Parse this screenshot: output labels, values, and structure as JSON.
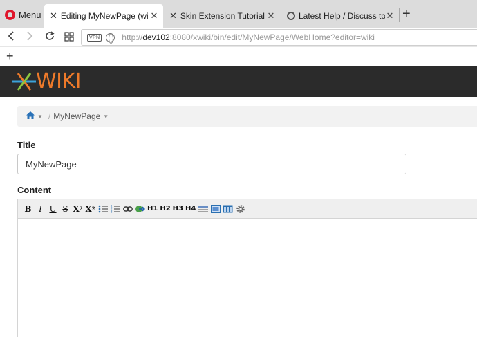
{
  "browser": {
    "menu_label": "Menu",
    "tabs": [
      {
        "title": "Editing MyNewPage (wiki",
        "favicon": "xwiki-x-icon",
        "active": true
      },
      {
        "title": "Skin Extension Tutorial (XW",
        "favicon": "xwiki-x-icon",
        "active": false
      },
      {
        "title": "Latest Help / Discuss topic",
        "favicon": "discourse-icon",
        "active": false
      }
    ],
    "url": {
      "protocol": "http://",
      "host": "dev102",
      "rest": ":8080/xwiki/bin/edit/MyNewPage/WebHome?editor=wiki"
    },
    "vpn_label": "VPN"
  },
  "xwiki": {
    "logo_text": "WIKI",
    "logo_color": "#ee7a2a",
    "breadcrumb": {
      "page": "MyNewPage"
    },
    "form": {
      "title_label": "Title",
      "title_value": "MyNewPage",
      "content_label": "Content"
    },
    "toolbar": {
      "bold": "B",
      "italic": "I",
      "underline": "U",
      "strike": "S",
      "subscript_base": "X",
      "subscript_mark": "2",
      "superscript_base": "X",
      "superscript_mark": "2",
      "h1": "H1",
      "h2": "H2",
      "h3": "H3",
      "h4": "H4"
    }
  }
}
